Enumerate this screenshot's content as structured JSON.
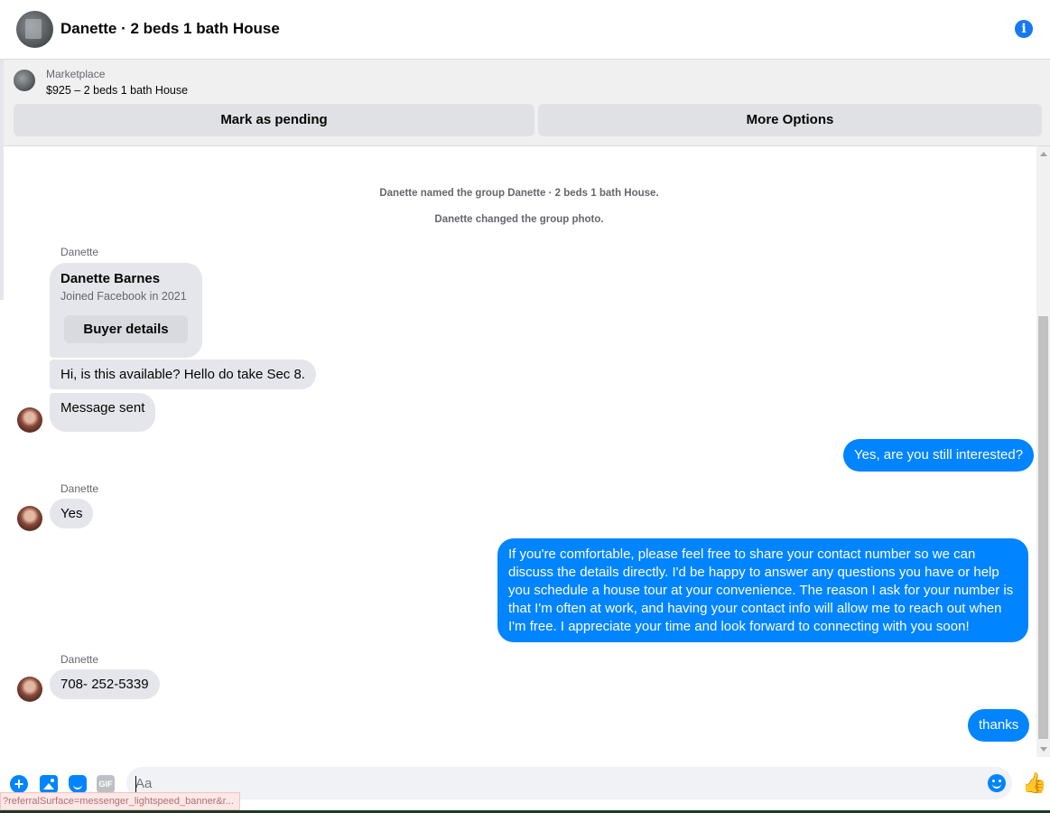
{
  "header": {
    "title": "Danette · 2 beds 1 bath House",
    "info_icon": "info-icon",
    "info_label": "i"
  },
  "marketplace": {
    "label": "Marketplace",
    "listing": "$925 – 2 beds 1 bath House",
    "pending_label": "Mark as pending",
    "options_label": "More Options"
  },
  "system_messages": [
    "Danette named the group Danette · 2 beds 1 bath House.",
    "Danette changed the group photo."
  ],
  "profile_card": {
    "name": "Danette Barnes",
    "joined": "Joined Facebook in 2021",
    "button_label": "Buyer details"
  },
  "messages": [
    {
      "from": "them",
      "sender": "Danette",
      "text": "Hi, is this available? Hello do take Sec 8."
    },
    {
      "from": "them",
      "text": "Message sent"
    },
    {
      "from": "me",
      "text": "Yes, are you still interested?"
    },
    {
      "from": "them",
      "sender": "Danette",
      "text": "Yes"
    },
    {
      "from": "me",
      "text": "If you're comfortable, please feel free to share your contact number so we can discuss the details directly. I'd be happy to answer any questions you have or help you schedule a house tour at your convenience. The reason I ask for your number is that I'm often at work, and having your contact info will allow me to reach out when I'm free. I appreciate your time and look forward to connecting with you soon!"
    },
    {
      "from": "them",
      "sender": "Danette",
      "text": "708- 252-5339"
    },
    {
      "from": "me",
      "text": "thanks"
    }
  ],
  "composer": {
    "placeholder": "Aa",
    "add_label": "+",
    "gif_label": "GIF",
    "like_label": "👍"
  },
  "status_bar": {
    "url": "?referralSurface=messenger_lightspeed_banner&r..."
  },
  "colors": {
    "accent": "#0084ff",
    "incoming_bubble": "#e4e6eb",
    "outgoing_bubble": "#0084ff"
  }
}
